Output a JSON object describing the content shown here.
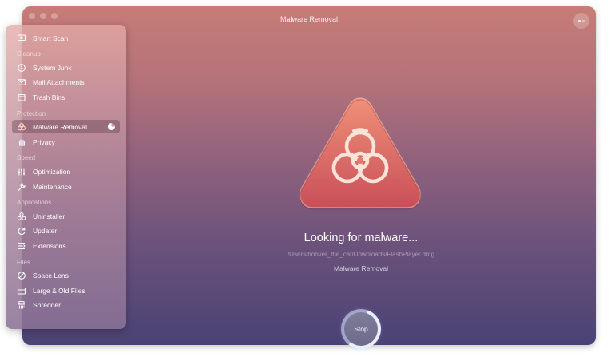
{
  "window": {
    "title": "Malware Removal"
  },
  "sidebar": {
    "items": [
      {
        "label": "Smart Scan",
        "icon": "smart-scan-icon"
      },
      {
        "label": "System Junk",
        "icon": "system-junk-icon"
      },
      {
        "label": "Mail Attachments",
        "icon": "mail-icon"
      },
      {
        "label": "Trash Bins",
        "icon": "trash-icon"
      },
      {
        "label": "Malware Removal",
        "icon": "biohazard-icon",
        "active": true
      },
      {
        "label": "Privacy",
        "icon": "hand-icon"
      },
      {
        "label": "Optimization",
        "icon": "sliders-icon"
      },
      {
        "label": "Maintenance",
        "icon": "wrench-icon"
      },
      {
        "label": "Uninstaller",
        "icon": "uninstaller-icon"
      },
      {
        "label": "Updater",
        "icon": "updater-icon"
      },
      {
        "label": "Extensions",
        "icon": "extensions-icon"
      },
      {
        "label": "Space Lens",
        "icon": "space-lens-icon"
      },
      {
        "label": "Large & Old Files",
        "icon": "folder-icon"
      },
      {
        "label": "Shredder",
        "icon": "shredder-icon"
      }
    ],
    "sections": {
      "cleanup": "Cleanup",
      "protection": "Protection",
      "speed": "Speed",
      "applications": "Applications",
      "files": "Files"
    }
  },
  "main": {
    "status": "Looking for malware...",
    "path": "/Users/hoover_the_cat/Downloads/FlashPlayer.dmg",
    "module": "Malware Removal",
    "stop_label": "Stop",
    "scan_progress": 0.55
  },
  "colors": {
    "hero_top": "#ef9078",
    "hero_bottom": "#c94f58",
    "window_top": "#c77c76",
    "window_bottom": "#4a4275"
  }
}
